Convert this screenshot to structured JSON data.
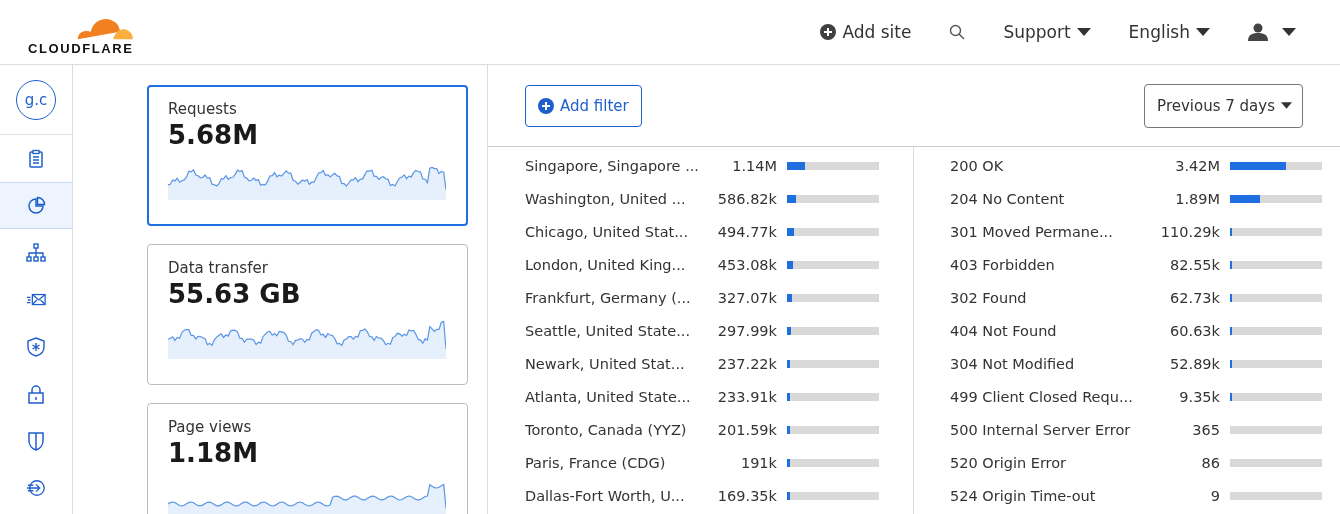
{
  "header": {
    "logo": "CLOUDFLARE",
    "add_site": "Add site",
    "support": "Support",
    "language": "English"
  },
  "sidebar": {
    "avatar": "g.c",
    "items": [
      {
        "selected": false
      },
      {
        "selected": true
      },
      {
        "selected": false
      },
      {
        "selected": false
      },
      {
        "selected": false
      },
      {
        "selected": false
      },
      {
        "selected": false
      },
      {
        "selected": false
      }
    ]
  },
  "cards": [
    {
      "label": "Requests",
      "value": "5.68M",
      "selected": true
    },
    {
      "label": "Data transfer",
      "value": "55.63 GB",
      "selected": false
    },
    {
      "label": "Page views",
      "value": "1.18M",
      "selected": false
    }
  ],
  "toolbar": {
    "add_filter": "Add filter",
    "time_range": "Previous 7 days"
  },
  "locations": [
    {
      "name": "Singapore, Singapore ...",
      "value": "1.14M",
      "level": 0.2
    },
    {
      "name": "Washington, United ...",
      "value": "586.82k",
      "level": 0.1
    },
    {
      "name": "Chicago, United Stat...",
      "value": "494.77k",
      "level": 0.08
    },
    {
      "name": "London, United King...",
      "value": "453.08k",
      "level": 0.07
    },
    {
      "name": "Frankfurt, Germany (...",
      "value": "327.07k",
      "level": 0.05
    },
    {
      "name": "Seattle, United State...",
      "value": "297.99k",
      "level": 0.045
    },
    {
      "name": "Newark, United Stat...",
      "value": "237.22k",
      "level": 0.035
    },
    {
      "name": "Atlanta, United State...",
      "value": "233.91k",
      "level": 0.035
    },
    {
      "name": "Toronto, Canada (YYZ)",
      "value": "201.59k",
      "level": 0.03
    },
    {
      "name": "Paris, France (CDG)",
      "value": "191k",
      "level": 0.03
    },
    {
      "name": "Dallas-Fort Worth, U...",
      "value": "169.35k",
      "level": 0.03
    }
  ],
  "status_codes": [
    {
      "name": "200 OK",
      "value": "3.42M",
      "level": 0.61
    },
    {
      "name": "204 No Content",
      "value": "1.89M",
      "level": 0.33
    },
    {
      "name": "301 Moved Permane...",
      "value": "110.29k",
      "level": 0.02
    },
    {
      "name": "403 Forbidden",
      "value": "82.55k",
      "level": 0.015
    },
    {
      "name": "302 Found",
      "value": "62.73k",
      "level": 0.012
    },
    {
      "name": "404 Not Found",
      "value": "60.63k",
      "level": 0.012
    },
    {
      "name": "304 Not Modified",
      "value": "52.89k",
      "level": 0.01
    },
    {
      "name": "499 Client Closed Requ...",
      "value": "9.35k",
      "level": 0.005
    },
    {
      "name": "500 Internal Server Error",
      "value": "365",
      "level": 0
    },
    {
      "name": "520 Origin Error",
      "value": "86",
      "level": 0
    },
    {
      "name": "524 Origin Time-out",
      "value": "9",
      "level": 0
    }
  ]
}
